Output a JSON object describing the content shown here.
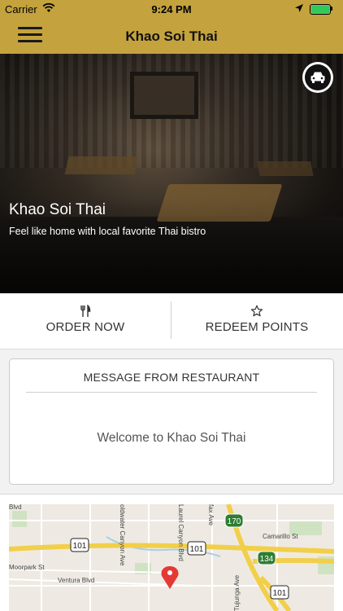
{
  "status_bar": {
    "carrier": "Carrier",
    "time": "9:24 PM"
  },
  "nav": {
    "title": "Khao Soi Thai"
  },
  "hero": {
    "title": "Khao Soi Thai",
    "subtitle": "Feel like home with local favorite Thai bistro"
  },
  "actions": [
    {
      "label": "ORDER NOW",
      "icon": "utensils-icon"
    },
    {
      "label": "REDEEM POINTS",
      "icon": "star-icon"
    }
  ],
  "message": {
    "title": "MESSAGE FROM RESTAURANT",
    "body": "Welcome to Khao Soi Thai"
  },
  "map": {
    "labels": {
      "bvd": "Blvd",
      "coldwater": "oldwater Canyon Ave",
      "laurel": "Laurel Canyon Blvd",
      "fax": "fax Ave",
      "camarillo": "Camarillo St",
      "moorpark": "Moorpark St",
      "ventura": "Ventura Blvd",
      "tujunga": "Tujunga Ave"
    },
    "shields": {
      "us101_a": "101",
      "us101_b": "101",
      "us101_c": "101",
      "ca170": "170",
      "ca134": "134"
    }
  },
  "colors": {
    "brand": "#c4a23e",
    "battery": "#34c759",
    "map_pin": "#e53935",
    "highway": "#f2cf4a"
  }
}
